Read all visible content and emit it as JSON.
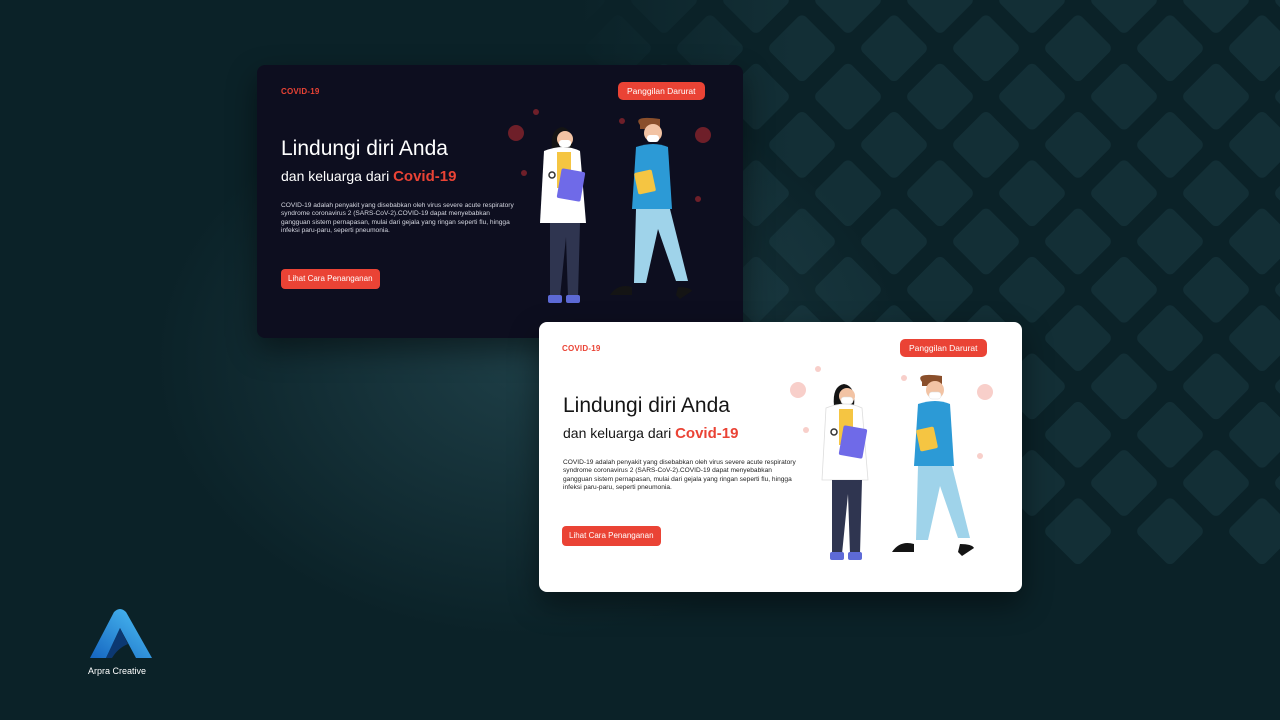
{
  "dark_card": {
    "brand": "COVID-19",
    "emergency_button": "Panggilan Darurat",
    "headline": "Lindungi diri Anda",
    "subheadline_prefix": "dan keluarga dari ",
    "subheadline_accent": "Covid-19",
    "description": "COVID-19 adalah penyakit yang disebabkan oleh virus severe acute respiratory syndrome coronavirus 2 (SARS-CoV-2).COVID-19 dapat menyebabkan gangguan sistem pernapasan, mulai dari gejala yang ringan seperti flu, hingga infeksi paru-paru, seperti pneumonia.",
    "cta_button": "Lihat Cara Penanganan"
  },
  "light_card": {
    "brand": "COVID-19",
    "emergency_button": "Panggilan Darurat",
    "headline": "Lindungi diri Anda",
    "subheadline_prefix": "dan keluarga dari ",
    "subheadline_accent": "Covid-19",
    "description": "COVID-19 adalah penyakit yang disebabkan oleh virus severe acute respiratory syndrome coronavirus 2 (SARS-CoV-2).COVID-19 dapat menyebabkan gangguan sistem pernapasan, mulai dari gejala yang ringan seperti flu, hingga infeksi paru-paru, seperti pneumonia.",
    "cta_button": "Lihat Cara Penanganan"
  },
  "logo": {
    "name": "Arpra Creative",
    "icon": "arpra-a-logo"
  },
  "colors": {
    "accent": "#ea4335",
    "background": "#0b2228",
    "dark_card": "#0d0e1f",
    "light_card": "#ffffff"
  }
}
